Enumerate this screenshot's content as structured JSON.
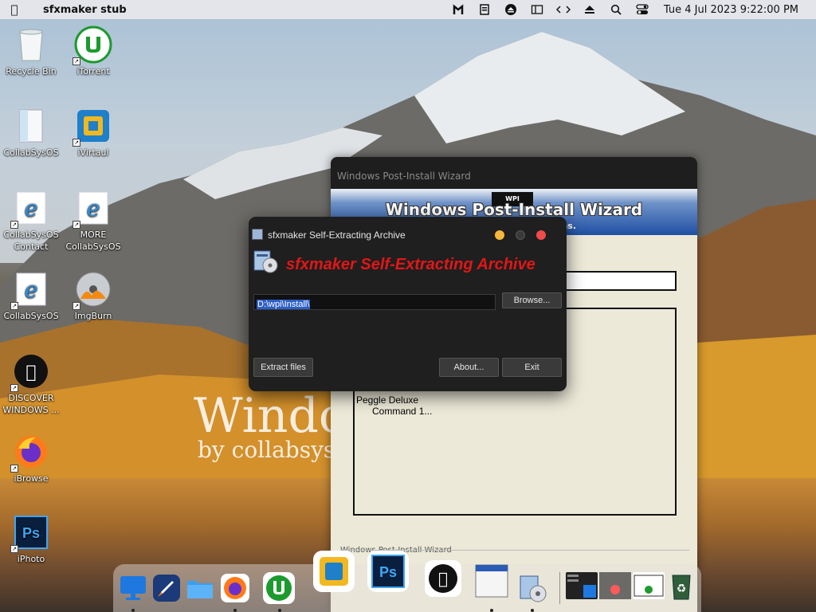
{
  "menubar": {
    "app_name": "sfxmaker stub",
    "clock": "Tue 4 Jul 2023  9:22:00 PM",
    "status_icons": [
      "malwarebytes-icon",
      "clipboard-icon",
      "eject-disc-icon",
      "sidebar-icon",
      "code-icon",
      "eject-icon",
      "search-icon",
      "control-center-icon"
    ]
  },
  "desktop_icons": [
    {
      "label": "Recycle Bin",
      "icon": "recycle-bin-icon"
    },
    {
      "label": "iTorrent",
      "icon": "utorrent-icon"
    },
    {
      "label": "CollabSysOS",
      "icon": "folder-icon"
    },
    {
      "label": "iVirtaul",
      "icon": "virtualbox-icon"
    },
    {
      "label": "CollabSysOS Contact",
      "icon": "ie-icon"
    },
    {
      "label": "MORE CollabSysOS",
      "icon": "ie-icon"
    },
    {
      "label": "CollabSysOS",
      "icon": "ie-icon"
    },
    {
      "label": "ImgBurn",
      "icon": "imgburn-icon"
    },
    {
      "label": "DISCOVER WINDOWS ...",
      "icon": "apple-icon"
    },
    {
      "label": "iBrowse",
      "icon": "firefox-icon"
    },
    {
      "label": "iPhoto",
      "icon": "photoshop-icon"
    }
  ],
  "wallpaper": {
    "line1": "Windo",
    "line2": "by collabsys"
  },
  "wpi_window": {
    "title": "Windows Post-Install Wizard",
    "logo": "WPI",
    "banner_title": "Windows Post-Install Wizard",
    "banner_sub": "ns.",
    "list": [
      "Peggle Deluxe",
      "Command 1..."
    ],
    "footer": "Windows Post-Install Wizard"
  },
  "sfx_dialog": {
    "title": "sfxmaker Self-Extracting Archive",
    "heading": "sfxmaker Self-Extracting Archive",
    "path_value": "D:\\wpi\\Install\\",
    "browse_label": "Browse...",
    "extract_label": "Extract files",
    "about_label": "About...",
    "exit_label": "Exit"
  },
  "dock": {
    "items": [
      "finder-icon",
      "launchpad-icon",
      "folder-icon",
      "firefox-icon",
      "utorrent-icon",
      "virtualbox-icon",
      "photoshop-icon",
      "apple-icon",
      "window-icon",
      "sfxmaker-icon"
    ],
    "recent": [
      "mission-control-thumb",
      "desktop-thumb",
      "window-thumb",
      "trash-icon"
    ]
  },
  "colors": {
    "menubar_bg": "#e8e8ec",
    "dialog_bg": "#1f1f1f",
    "dialog_heading": "#e31616",
    "selection": "#2d5fc9",
    "wpi_bg": "#ece9d8"
  }
}
